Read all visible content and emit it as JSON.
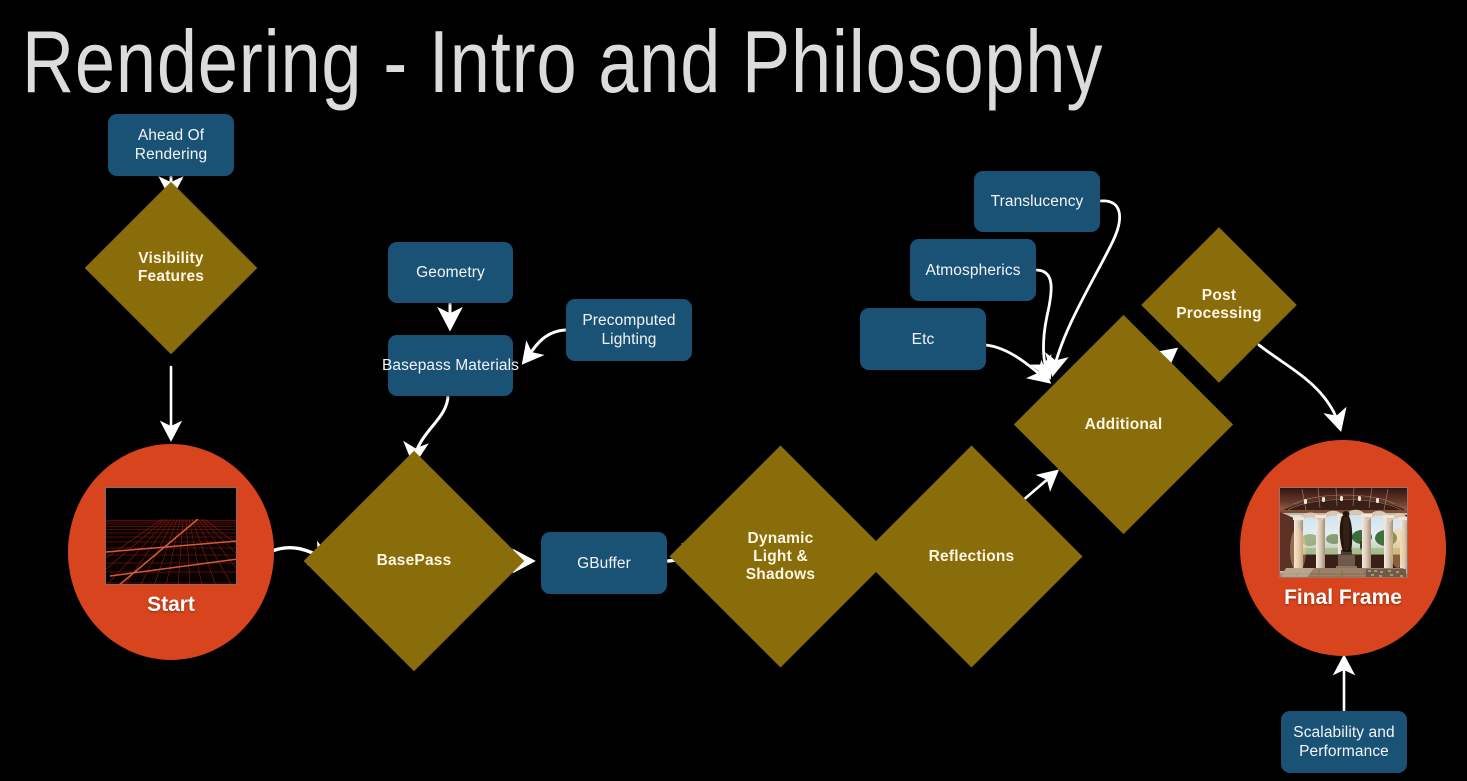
{
  "title": "Rendering - Intro and Philosophy",
  "colors": {
    "background": "#000000",
    "title_text": "#dcdcdc",
    "node_blue": "#1a5276",
    "node_gold": "#8a6d0b",
    "node_orange": "#d8441d",
    "edge_white": "#ffffff",
    "blue_text": "#f2f4f6",
    "gold_text": "#fdf6e3"
  },
  "diagram": {
    "type": "flowchart",
    "nodes": [
      {
        "id": "ahead_of_rendering",
        "label": "Ahead Of\nRendering",
        "shape": "rounded-rect",
        "color": "#1a5276"
      },
      {
        "id": "visibility_features",
        "label": "Visibility\nFeatures",
        "shape": "diamond",
        "color": "#8a6d0b"
      },
      {
        "id": "start",
        "label": "Start",
        "shape": "circle",
        "color": "#d8441d",
        "thumbnail": "wireframe-grid-image"
      },
      {
        "id": "geometry",
        "label": "Geometry",
        "shape": "rounded-rect",
        "color": "#1a5276"
      },
      {
        "id": "precomputed_lighting",
        "label": "Precomputed\nLighting",
        "shape": "rounded-rect",
        "color": "#1a5276"
      },
      {
        "id": "basepass_materials",
        "label": "Basepass Materials",
        "shape": "rounded-rect",
        "color": "#1a5276"
      },
      {
        "id": "basepass",
        "label": "BasePass",
        "shape": "diamond",
        "color": "#8a6d0b"
      },
      {
        "id": "gbuffer",
        "label": "GBuffer",
        "shape": "rounded-rect",
        "color": "#1a5276"
      },
      {
        "id": "dynamic_light",
        "label": "Dynamic\nLight &\nShadows",
        "shape": "diamond",
        "color": "#8a6d0b"
      },
      {
        "id": "reflections",
        "label": "Reflections",
        "shape": "diamond",
        "color": "#8a6d0b"
      },
      {
        "id": "translucency",
        "label": "Translucency",
        "shape": "rounded-rect",
        "color": "#1a5276"
      },
      {
        "id": "atmospherics",
        "label": "Atmospherics",
        "shape": "rounded-rect",
        "color": "#1a5276"
      },
      {
        "id": "etc",
        "label": "Etc",
        "shape": "rounded-rect",
        "color": "#1a5276"
      },
      {
        "id": "additional",
        "label": "Additional",
        "shape": "diamond",
        "color": "#8a6d0b"
      },
      {
        "id": "post_processing",
        "label": "Post\nProcessing",
        "shape": "diamond",
        "color": "#8a6d0b"
      },
      {
        "id": "final_frame",
        "label": "Final Frame",
        "shape": "circle",
        "color": "#d8441d",
        "thumbnail": "rotunda-render-image"
      },
      {
        "id": "scalability",
        "label": "Scalability and\nPerformance",
        "shape": "rounded-rect",
        "color": "#1a5276"
      }
    ],
    "edges": [
      {
        "from": "ahead_of_rendering",
        "to": "visibility_features",
        "style": "straight"
      },
      {
        "from": "visibility_features",
        "to": "start",
        "style": "straight"
      },
      {
        "from": "start",
        "to": "basepass",
        "style": "curved"
      },
      {
        "from": "geometry",
        "to": "basepass_materials",
        "style": "straight"
      },
      {
        "from": "precomputed_lighting",
        "to": "basepass_materials",
        "style": "curved"
      },
      {
        "from": "basepass_materials",
        "to": "basepass",
        "style": "curved"
      },
      {
        "from": "basepass",
        "to": "gbuffer",
        "style": "straight"
      },
      {
        "from": "gbuffer",
        "to": "dynamic_light",
        "style": "straight"
      },
      {
        "from": "dynamic_light",
        "to": "reflections",
        "style": "straight"
      },
      {
        "from": "reflections",
        "to": "additional",
        "style": "straight"
      },
      {
        "from": "translucency",
        "to": "additional",
        "style": "curved"
      },
      {
        "from": "atmospherics",
        "to": "additional",
        "style": "curved"
      },
      {
        "from": "etc",
        "to": "additional",
        "style": "curved"
      },
      {
        "from": "additional",
        "to": "post_processing",
        "style": "straight"
      },
      {
        "from": "post_processing",
        "to": "final_frame",
        "style": "curved"
      },
      {
        "from": "scalability",
        "to": "final_frame",
        "style": "straight"
      }
    ]
  }
}
